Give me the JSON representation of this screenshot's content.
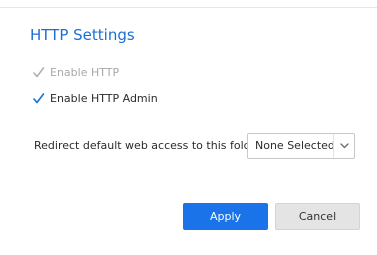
{
  "section": {
    "title": "HTTP Settings"
  },
  "options": {
    "enable_http": {
      "label": "Enable HTTP",
      "checked": true,
      "disabled": true
    },
    "enable_http_admin": {
      "label": "Enable HTTP Admin",
      "checked": true,
      "disabled": false
    }
  },
  "redirect": {
    "label": "Redirect default web access to this folder:",
    "selected": "None Selected",
    "icon": "chevron-down-icon"
  },
  "actions": {
    "apply_label": "Apply",
    "cancel_label": "Cancel"
  },
  "colors": {
    "accent": "#1a6fd6",
    "primary_button": "#1a73e8",
    "secondary_button": "#e4e4e4",
    "disabled_text": "#a8a8a8"
  }
}
